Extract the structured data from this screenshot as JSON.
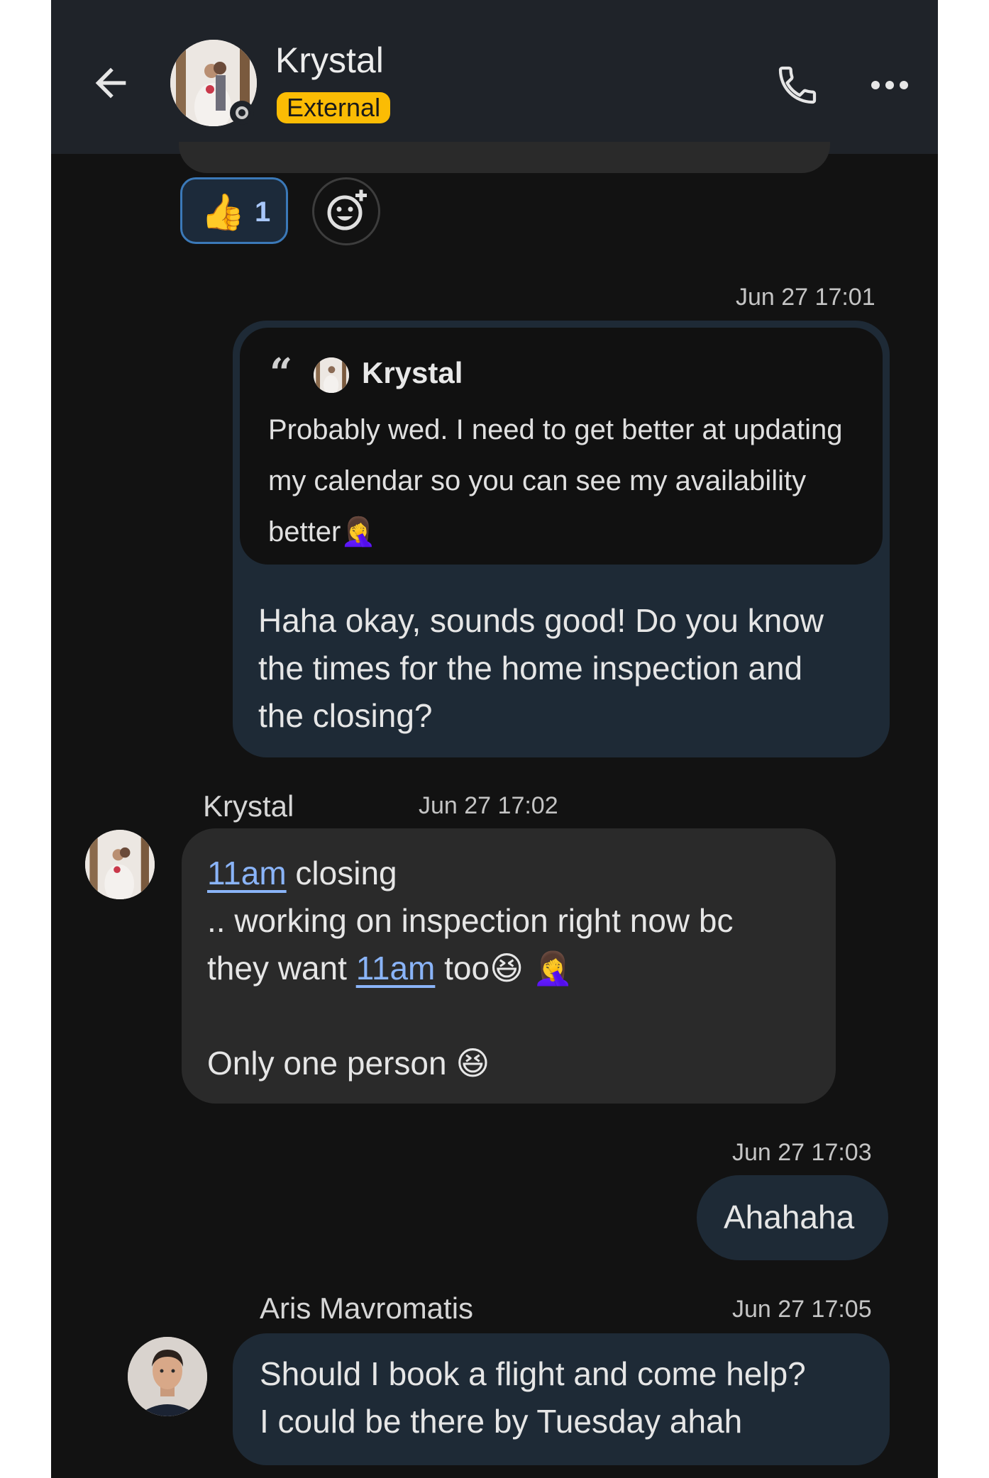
{
  "header": {
    "contact_name": "Krystal",
    "badge": "External"
  },
  "reactions": {
    "chip_emoji": "👍",
    "chip_count": "1"
  },
  "messages": [
    {
      "timestamp": "Jun 27 17:01",
      "quote": {
        "author": "Krystal",
        "text": "Probably wed. I need to get better at updating my calendar so you can see my availability better🤦‍♀️"
      },
      "text": "Haha okay, sounds good! Do you know the times for the home inspection and the closing?"
    },
    {
      "sender": "Krystal",
      "timestamp": "Jun 27 17:02",
      "link_1": "11am",
      "text_1": " closing",
      "text_2": ".. working on inspection right now bc",
      "text_3a": "they want ",
      "link_2": "11am",
      "text_3b": " too😆 🤦‍♀️",
      "text_4": "Only one person 😆"
    },
    {
      "timestamp": "Jun 27 17:03",
      "text": "Ahahaha"
    },
    {
      "sender": "Aris Mavromatis",
      "timestamp": "Jun 27 17:05",
      "text_1": "Should I book a flight and come help?",
      "text_2": "I could be there by Tuesday ahah"
    }
  ],
  "icons": {
    "back": "arrow-back-icon",
    "call": "phone-icon",
    "more": "more-horizontal-icon",
    "add_reaction": "add-reaction-icon",
    "quote": "quote-icon"
  },
  "colors": {
    "background": "#121212",
    "header": "#1f2329",
    "outgoing_bubble": "#1e2a36",
    "incoming_bubble": "#2a2a2a",
    "badge": "#fbbc04",
    "link": "#8ab4f8",
    "reaction_border": "#3b79b8"
  }
}
